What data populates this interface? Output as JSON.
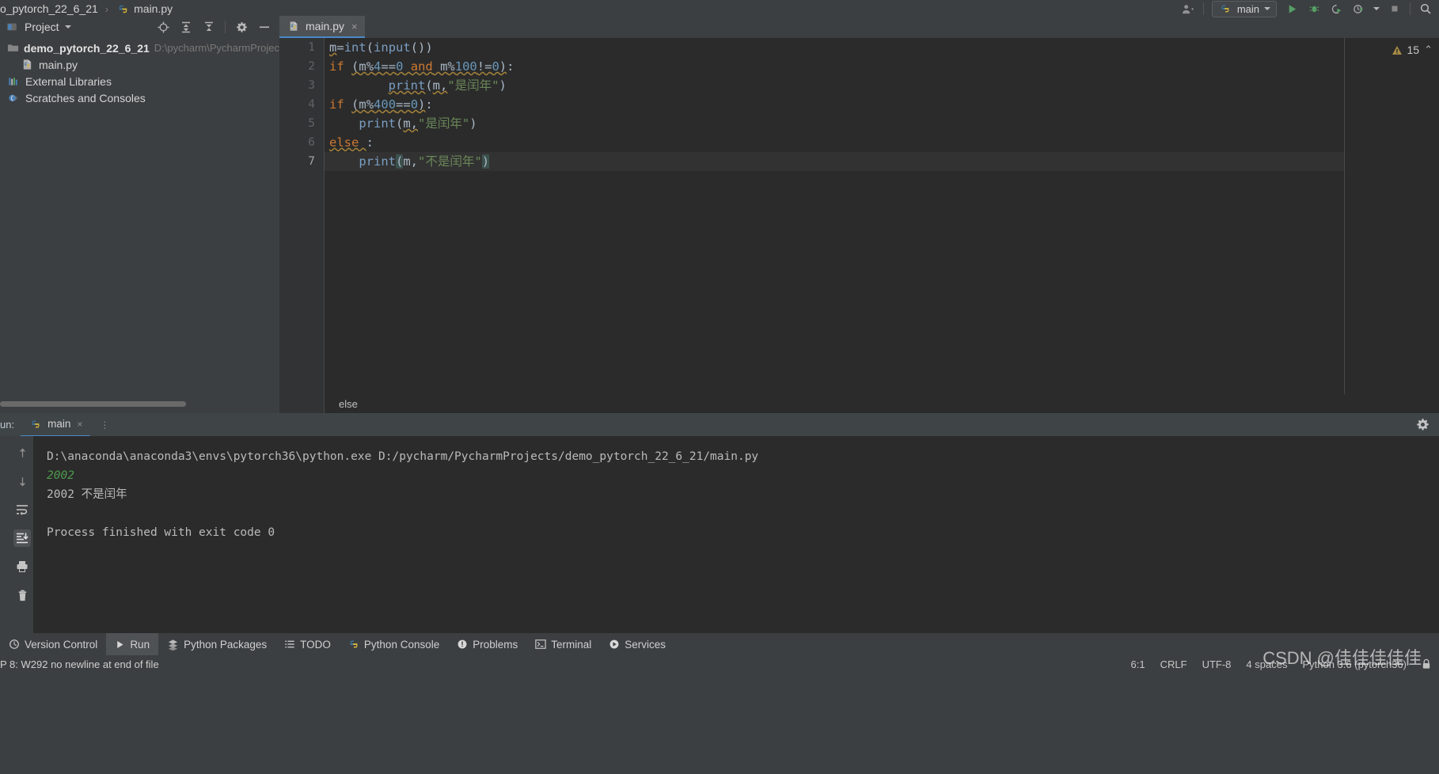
{
  "window": {
    "breadcrumb_project": "o_pytorch_22_6_21",
    "breadcrumb_sep": "›",
    "breadcrumb_file": "main.py"
  },
  "toolbar": {
    "run_config_label": "main",
    "icons": [
      "user-avatar-icon",
      "python-icon",
      "chevron-down-icon",
      "run-icon",
      "debug-icon",
      "run-coverage-icon",
      "profile-icon",
      "stop-icon",
      "search-icon",
      "settings-icon"
    ]
  },
  "project_panel": {
    "title": "Project",
    "tools": [
      "locate-icon",
      "expand-all-icon",
      "collapse-all-icon",
      "gear-icon",
      "hide-icon"
    ],
    "tree": [
      {
        "label": "demo_pytorch_22_6_21",
        "path": "D:\\pycharm\\PycharmProjec",
        "icon": "folder-icon",
        "indent": 0
      },
      {
        "label": "main.py",
        "path": "",
        "icon": "python-file-icon",
        "indent": 1
      },
      {
        "label": "External Libraries",
        "path": "",
        "icon": "libraries-icon",
        "indent": 0
      },
      {
        "label": "Scratches and Consoles",
        "path": "",
        "icon": "scratches-icon",
        "indent": 0
      }
    ]
  },
  "editor": {
    "tab_label": "main.py",
    "tab_close": "×",
    "warning_count": "15",
    "warning_chevron": "⌃",
    "breadcrumb": "else",
    "lines": [
      {
        "n": "1",
        "text": "m=int(input())"
      },
      {
        "n": "2",
        "text": "if (m%4==0 and m%100!=0):"
      },
      {
        "n": "3",
        "text": "        print(m,\"是闰年\")"
      },
      {
        "n": "4",
        "text": "if (m%400==0):"
      },
      {
        "n": "5",
        "text": "    print(m,\"是闰年\")"
      },
      {
        "n": "6",
        "text": "else :"
      },
      {
        "n": "7",
        "text": "    print(m,\"不是闰年\")"
      }
    ]
  },
  "run_window": {
    "label": "un:",
    "tab_label": "main",
    "tab_close": "×",
    "side_icons": [
      "up-arrow-icon",
      "down-arrow-icon",
      "soft-wrap-icon",
      "scroll-to-end-icon",
      "print-icon",
      "trash-icon"
    ],
    "gear": "gear-icon",
    "console": [
      {
        "text": "D:\\anaconda\\anaconda3\\envs\\pytorch36\\python.exe D:/pycharm/PycharmProjects/demo_pytorch_22_6_21/main.py",
        "style": "normal"
      },
      {
        "text": "2002",
        "style": "green"
      },
      {
        "text": "2002 不是闰年",
        "style": "normal"
      },
      {
        "text": "",
        "style": "blank"
      },
      {
        "text": "Process finished with exit code 0",
        "style": "normal"
      }
    ]
  },
  "bottom_bar": {
    "tabs": [
      {
        "label": "Version Control",
        "icon": "version-control-icon",
        "selected": false
      },
      {
        "label": "Run",
        "icon": "run-icon",
        "selected": true
      },
      {
        "label": "Python Packages",
        "icon": "packages-icon",
        "selected": false
      },
      {
        "label": "TODO",
        "icon": "todo-icon",
        "selected": false
      },
      {
        "label": "Python Console",
        "icon": "python-icon",
        "selected": false
      },
      {
        "label": "Problems",
        "icon": "problems-icon",
        "selected": false
      },
      {
        "label": "Terminal",
        "icon": "terminal-icon",
        "selected": false
      },
      {
        "label": "Services",
        "icon": "services-icon",
        "selected": false
      }
    ]
  },
  "status_bar": {
    "message": "P 8: W292 no newline at end of file",
    "caret": "6:1",
    "line_separator": "CRLF",
    "encoding": "UTF-8",
    "indent": "4 spaces",
    "interpreter": "Python 3.6 (pytorch36)",
    "lock": "🔒",
    "watermark": "CSDN @佳佳佳佳佳"
  },
  "colors": {
    "accent": "#4a88c7",
    "keyword": "#cc7832",
    "string": "#6a8759",
    "number": "#6897bb",
    "editor_bg": "#2b2b2b",
    "panel_bg": "#3c3f41",
    "console_input": "#4e9a4e"
  }
}
